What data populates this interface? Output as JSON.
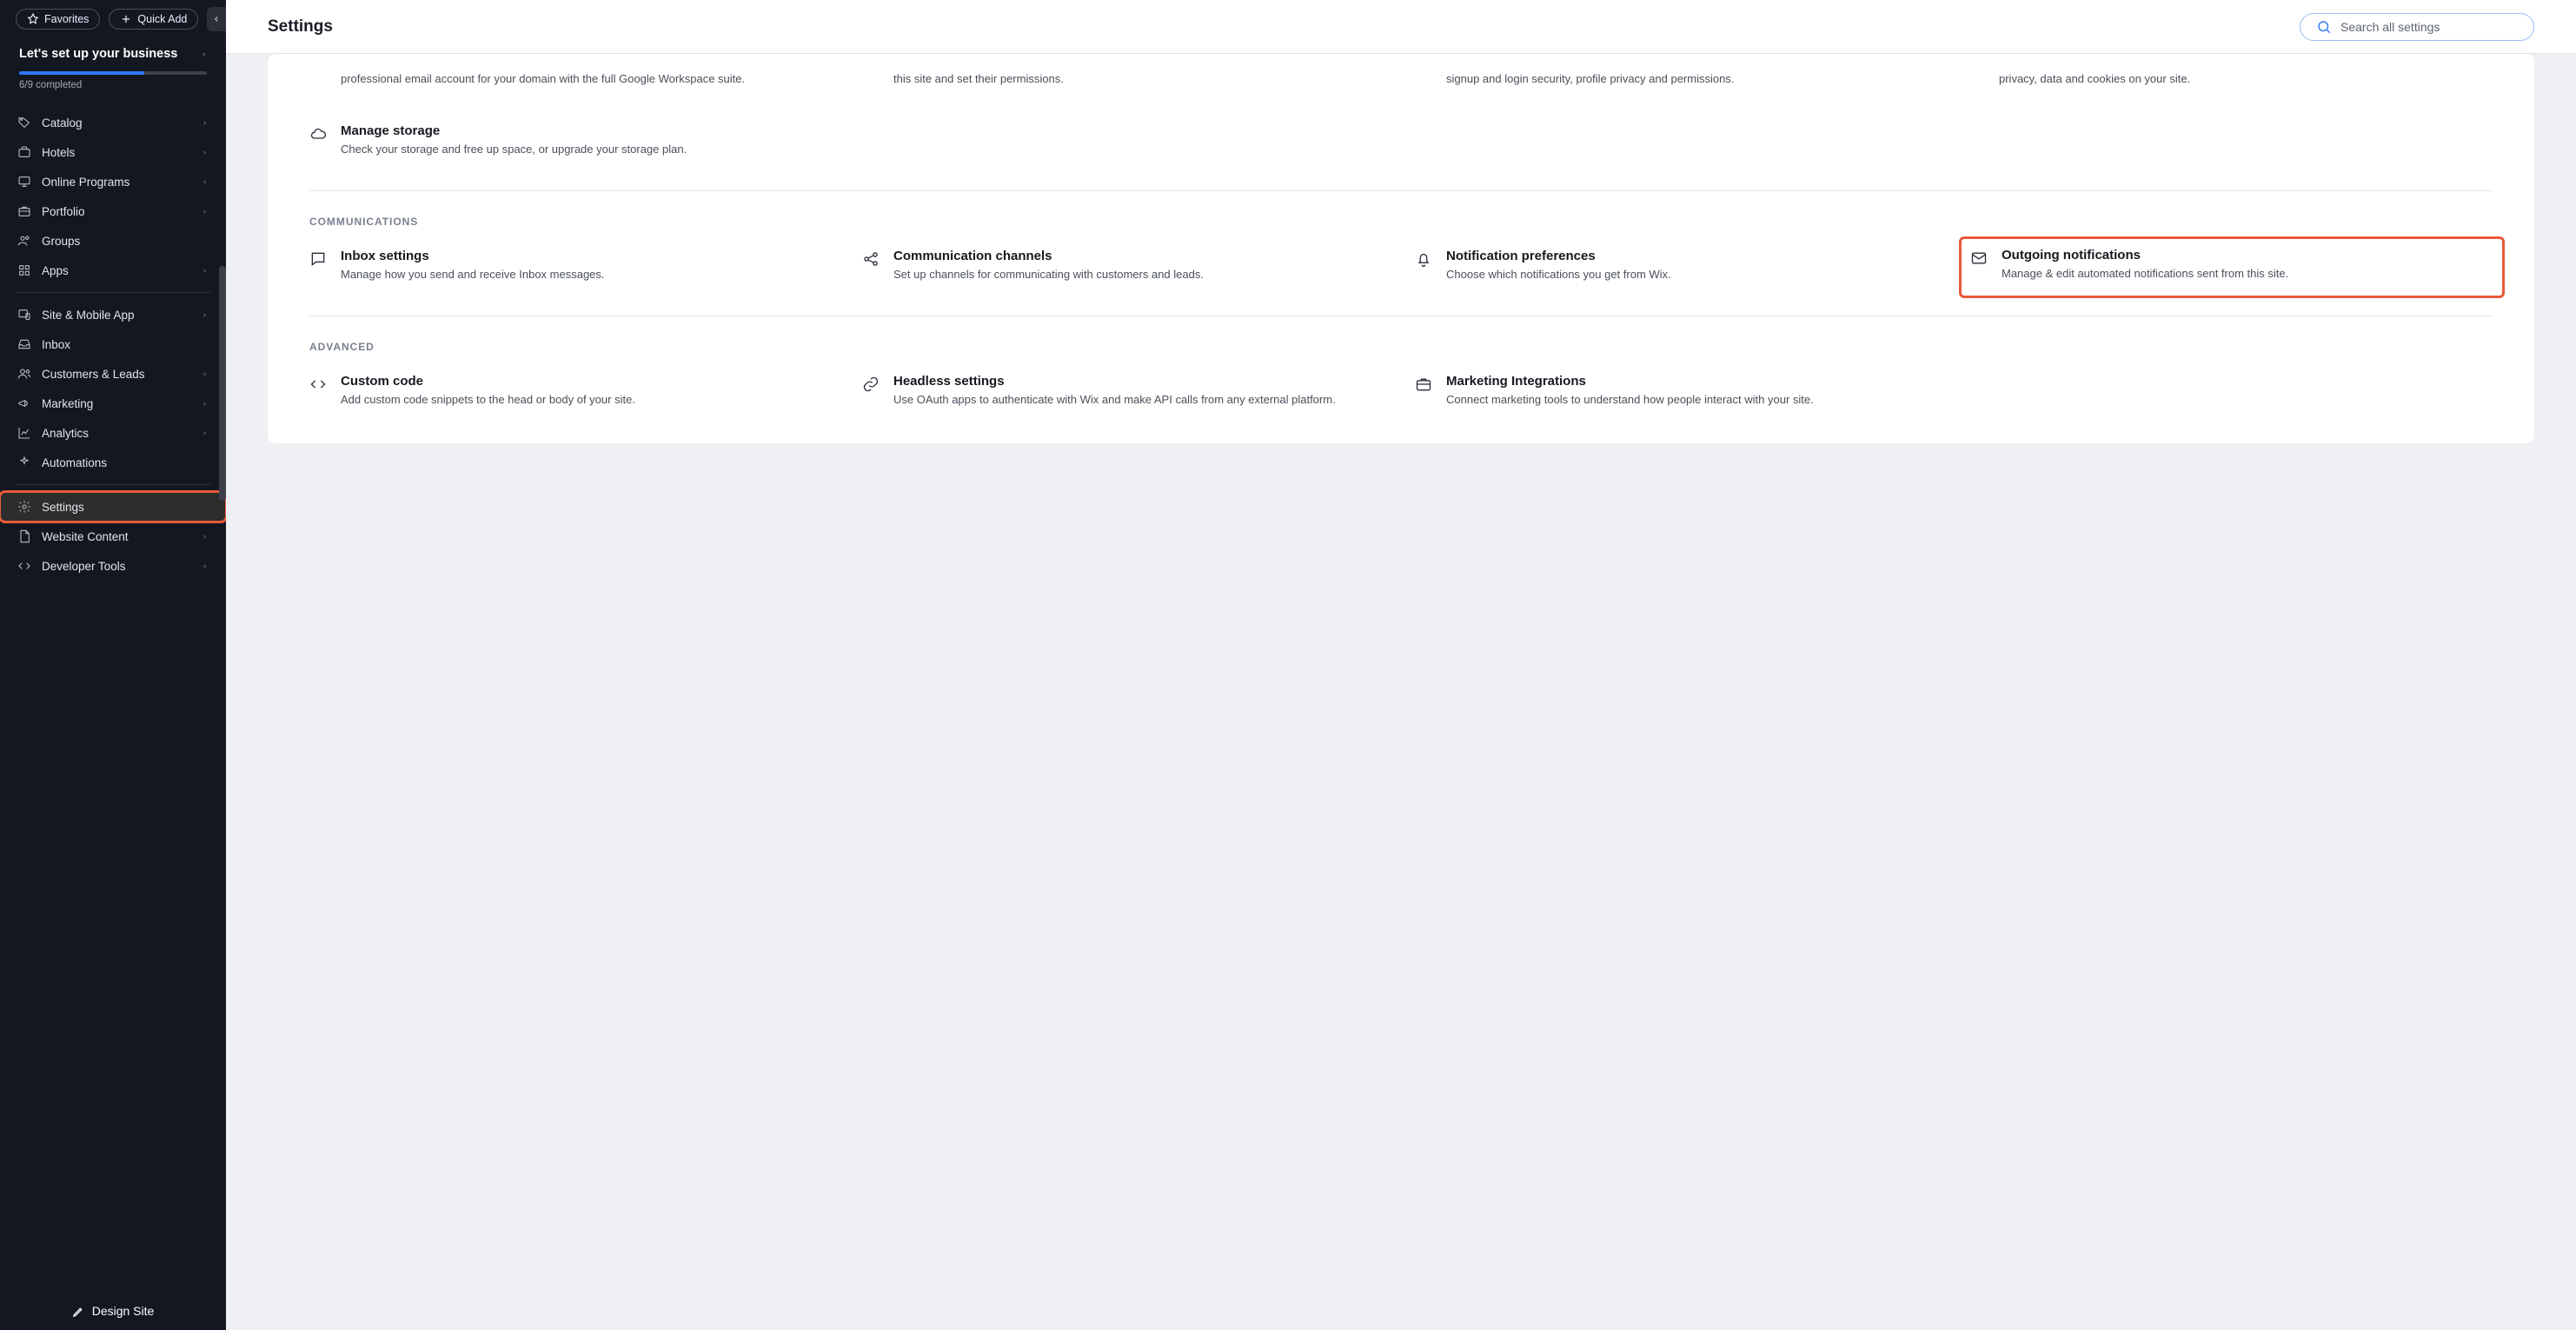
{
  "topbar": {
    "favorites_label": "Favorites",
    "quick_add_label": "Quick Add"
  },
  "setup": {
    "title": "Let's set up your business",
    "progress_completed": 6,
    "progress_total": 9,
    "completed_text": "6/9 completed"
  },
  "sidebar": {
    "items": [
      {
        "icon": "tag",
        "label": "Catalog",
        "chev": true
      },
      {
        "icon": "suitcase",
        "label": "Hotels",
        "chev": true
      },
      {
        "icon": "monitor",
        "label": "Online Programs",
        "chev": true
      },
      {
        "icon": "briefcase",
        "label": "Portfolio",
        "chev": true
      },
      {
        "icon": "people",
        "label": "Groups",
        "chev": false
      },
      {
        "icon": "grid",
        "label": "Apps",
        "chev": true
      }
    ],
    "items2": [
      {
        "icon": "device",
        "label": "Site & Mobile App",
        "chev": true
      },
      {
        "icon": "tray",
        "label": "Inbox",
        "chev": false
      },
      {
        "icon": "users",
        "label": "Customers & Leads",
        "chev": true
      },
      {
        "icon": "megaphone",
        "label": "Marketing",
        "chev": true
      },
      {
        "icon": "chart",
        "label": "Analytics",
        "chev": true
      },
      {
        "icon": "sparkle",
        "label": "Automations",
        "chev": false
      }
    ],
    "items3": [
      {
        "icon": "gear",
        "label": "Settings",
        "chev": false,
        "selected": true,
        "hl": true
      },
      {
        "icon": "page",
        "label": "Website Content",
        "chev": true
      },
      {
        "icon": "code",
        "label": "Developer Tools",
        "chev": true
      }
    ],
    "design_btn": "Design Site"
  },
  "header": {
    "title": "Settings",
    "search_placeholder": "Search all settings"
  },
  "content": {
    "top_row": [
      {
        "icon": "",
        "title": "",
        "desc": "professional email account for your domain with the full Google Workspace suite."
      },
      {
        "icon": "",
        "title": "",
        "desc": "this site and set their permissions."
      },
      {
        "icon": "",
        "title": "",
        "desc": "signup and login security, profile privacy and permissions."
      },
      {
        "icon": "",
        "title": "",
        "desc": "privacy, data and cookies on your site."
      }
    ],
    "storage": {
      "title": "Manage storage",
      "desc": "Check your storage and free up space, or upgrade your storage plan."
    },
    "communications_label": "Communications",
    "communications": [
      {
        "icon": "chat",
        "title": "Inbox settings",
        "desc": "Manage how you send and receive Inbox messages."
      },
      {
        "icon": "share",
        "title": "Communication channels",
        "desc": "Set up channels for communicating with customers and leads."
      },
      {
        "icon": "bell",
        "title": "Notification preferences",
        "desc": "Choose which notifications you get from Wix."
      },
      {
        "icon": "mail",
        "title": "Outgoing notifications",
        "desc": "Manage & edit automated notifications sent from this site.",
        "hl": true
      }
    ],
    "advanced_label": "Advanced",
    "advanced": [
      {
        "icon": "code",
        "title": "Custom code",
        "desc": "Add custom code snippets to the head or body of your site."
      },
      {
        "icon": "link",
        "title": "Headless settings",
        "desc": "Use OAuth apps to authenticate with Wix and make API calls from any external platform."
      },
      {
        "icon": "briefcase",
        "title": "Marketing Integrations",
        "desc": "Connect marketing tools to understand how people interact with your site."
      }
    ]
  }
}
